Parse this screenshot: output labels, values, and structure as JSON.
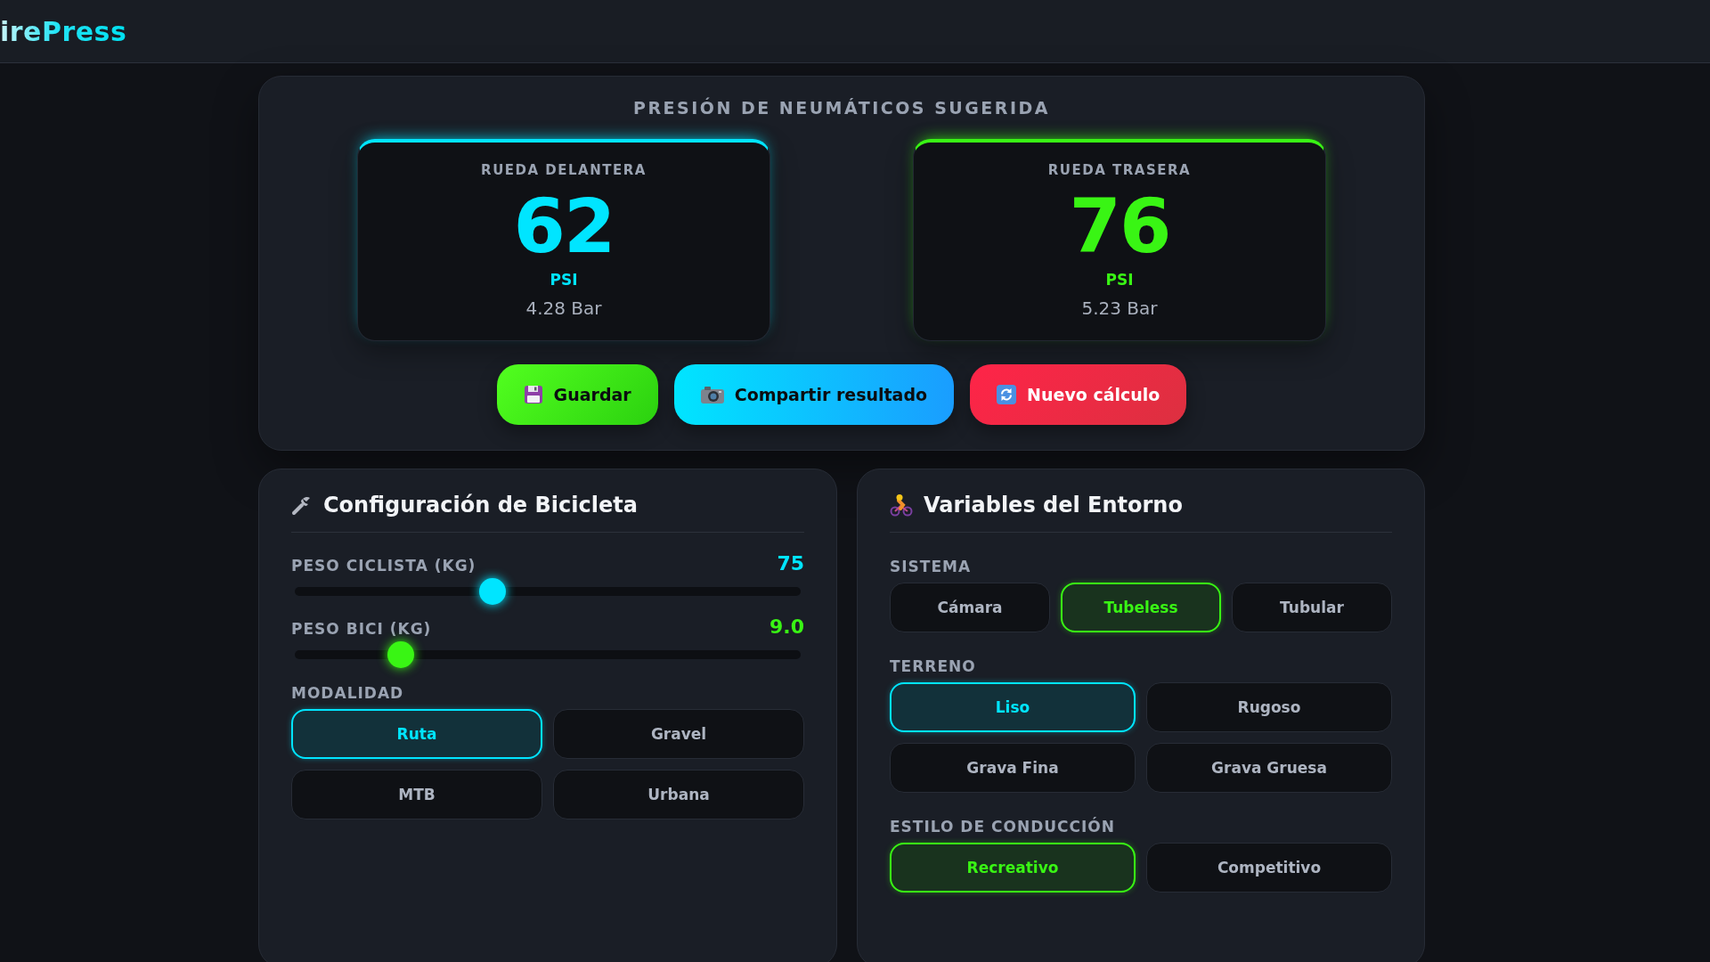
{
  "header": {
    "logo": "irePress"
  },
  "results": {
    "title": "PRESIÓN DE NEUMÁTICOS SUGERIDA",
    "wheels": [
      {
        "label": "RUEDA DELANTERA",
        "value": "62",
        "unit": "PSI",
        "bar": "4.28 Bar",
        "color": "#00e5ff"
      },
      {
        "label": "RUEDA TRASERA",
        "value": "76",
        "unit": "PSI",
        "bar": "5.23 Bar",
        "color": "#39f514"
      }
    ],
    "actions": [
      {
        "kind": "save",
        "label": "Guardar"
      },
      {
        "kind": "share",
        "label": "Compartir resultado"
      },
      {
        "kind": "reset",
        "label": "Nuevo cálculo"
      }
    ]
  },
  "bike_config": {
    "title": "Configuración de Bicicleta",
    "sliders": [
      {
        "label": "PESO CICLISTA (KG)",
        "reading": "75",
        "level": 0.39,
        "color": "#00e5ff"
      },
      {
        "label": "PESO BICI (KG)",
        "reading": "9.0",
        "level": 0.21,
        "color": "#39f514"
      }
    ],
    "groups": [
      {
        "label": "MODALIDAD",
        "color": "#00e5ff",
        "options": [
          {
            "label": "Ruta",
            "selected": true
          },
          {
            "label": "Gravel",
            "selected": false
          },
          {
            "label": "MTB",
            "selected": false
          },
          {
            "label": "Urbana",
            "selected": false
          }
        ]
      }
    ]
  },
  "environment": {
    "title": "Variables del Entorno",
    "groups": [
      {
        "label": "SISTEMA",
        "color": "#39f514",
        "options": [
          {
            "label": "Cámara",
            "selected": false
          },
          {
            "label": "Tubeless",
            "selected": true
          },
          {
            "label": "Tubular",
            "selected": false
          }
        ]
      },
      {
        "label": "TERRENO",
        "color": "#00e5ff",
        "options": [
          {
            "label": "Liso",
            "selected": true
          },
          {
            "label": "Rugoso",
            "selected": false
          },
          {
            "label": "Grava Fina",
            "selected": false
          },
          {
            "label": "Grava Gruesa",
            "selected": false
          }
        ]
      },
      {
        "label": "ESTILO DE CONDUCCIÓN",
        "color": "#39f514",
        "options": [
          {
            "label": "Recreativo",
            "selected": true
          },
          {
            "label": "Competitivo",
            "selected": false
          }
        ]
      }
    ]
  }
}
